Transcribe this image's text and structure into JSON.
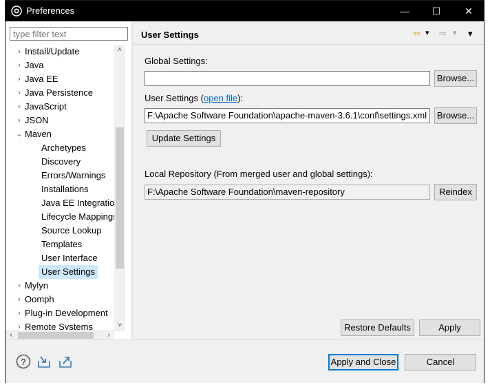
{
  "window": {
    "title": "Preferences",
    "minimize_glyph": "—",
    "maximize_glyph": "☐",
    "close_glyph": "✕"
  },
  "filter": {
    "placeholder": "type filter text",
    "value": ""
  },
  "tree": {
    "items": [
      {
        "label": "Install/Update",
        "level": 0,
        "expander": "›"
      },
      {
        "label": "Java",
        "level": 0,
        "expander": "›"
      },
      {
        "label": "Java EE",
        "level": 0,
        "expander": "›"
      },
      {
        "label": "Java Persistence",
        "level": 0,
        "expander": "›"
      },
      {
        "label": "JavaScript",
        "level": 0,
        "expander": "›"
      },
      {
        "label": "JSON",
        "level": 0,
        "expander": "›"
      },
      {
        "label": "Maven",
        "level": 0,
        "expander": "⌄"
      },
      {
        "label": "Archetypes",
        "level": 1,
        "expander": ""
      },
      {
        "label": "Discovery",
        "level": 1,
        "expander": ""
      },
      {
        "label": "Errors/Warnings",
        "level": 1,
        "expander": ""
      },
      {
        "label": "Installations",
        "level": 1,
        "expander": ""
      },
      {
        "label": "Java EE Integration",
        "level": 1,
        "expander": ""
      },
      {
        "label": "Lifecycle Mappings",
        "level": 1,
        "expander": ""
      },
      {
        "label": "Source Lookup",
        "level": 1,
        "expander": ""
      },
      {
        "label": "Templates",
        "level": 1,
        "expander": ""
      },
      {
        "label": "User Interface",
        "level": 1,
        "expander": ""
      },
      {
        "label": "User Settings",
        "level": 1,
        "expander": "",
        "selected": true
      },
      {
        "label": "Mylyn",
        "level": 0,
        "expander": "›"
      },
      {
        "label": "Oomph",
        "level": 0,
        "expander": "›"
      },
      {
        "label": "Plug-in Development",
        "level": 0,
        "expander": "›"
      },
      {
        "label": "Remote Systems",
        "level": 0,
        "expander": "›"
      }
    ],
    "scroll_up": "˄",
    "scroll_down": "˅",
    "scroll_left": "‹",
    "scroll_right": "›"
  },
  "page": {
    "title": "User Settings",
    "nav": {
      "back": "⇦",
      "back_menu": "▾",
      "forward": "⇨",
      "forward_menu": "▾",
      "view_menu": "▾"
    }
  },
  "settings": {
    "global_label": "Global Settings:",
    "global_value": "",
    "browse_label": "Browse...",
    "user_label_prefix": "User Settings (",
    "user_link": "open file",
    "user_label_suffix": "):",
    "user_value": "F:\\Apache Software Foundation\\apache-maven-3.6.1\\conf\\settings.xml",
    "update_label": "Update Settings",
    "local_repo_label": "Local Repository (From merged user and global settings):",
    "local_repo_value": "F:\\Apache Software Foundation\\maven-repository",
    "reindex_label": "Reindex"
  },
  "actions": {
    "restore_defaults": "Restore Defaults",
    "apply": "Apply",
    "apply_and_close": "Apply and Close",
    "cancel": "Cancel"
  },
  "icons": {
    "help": "help-icon",
    "import": "import-icon",
    "export": "export-icon"
  },
  "colors": {
    "selection": "#cce8ff",
    "link": "#0066cc",
    "default_button_border": "#0078d7",
    "titlebar": "#000000"
  }
}
